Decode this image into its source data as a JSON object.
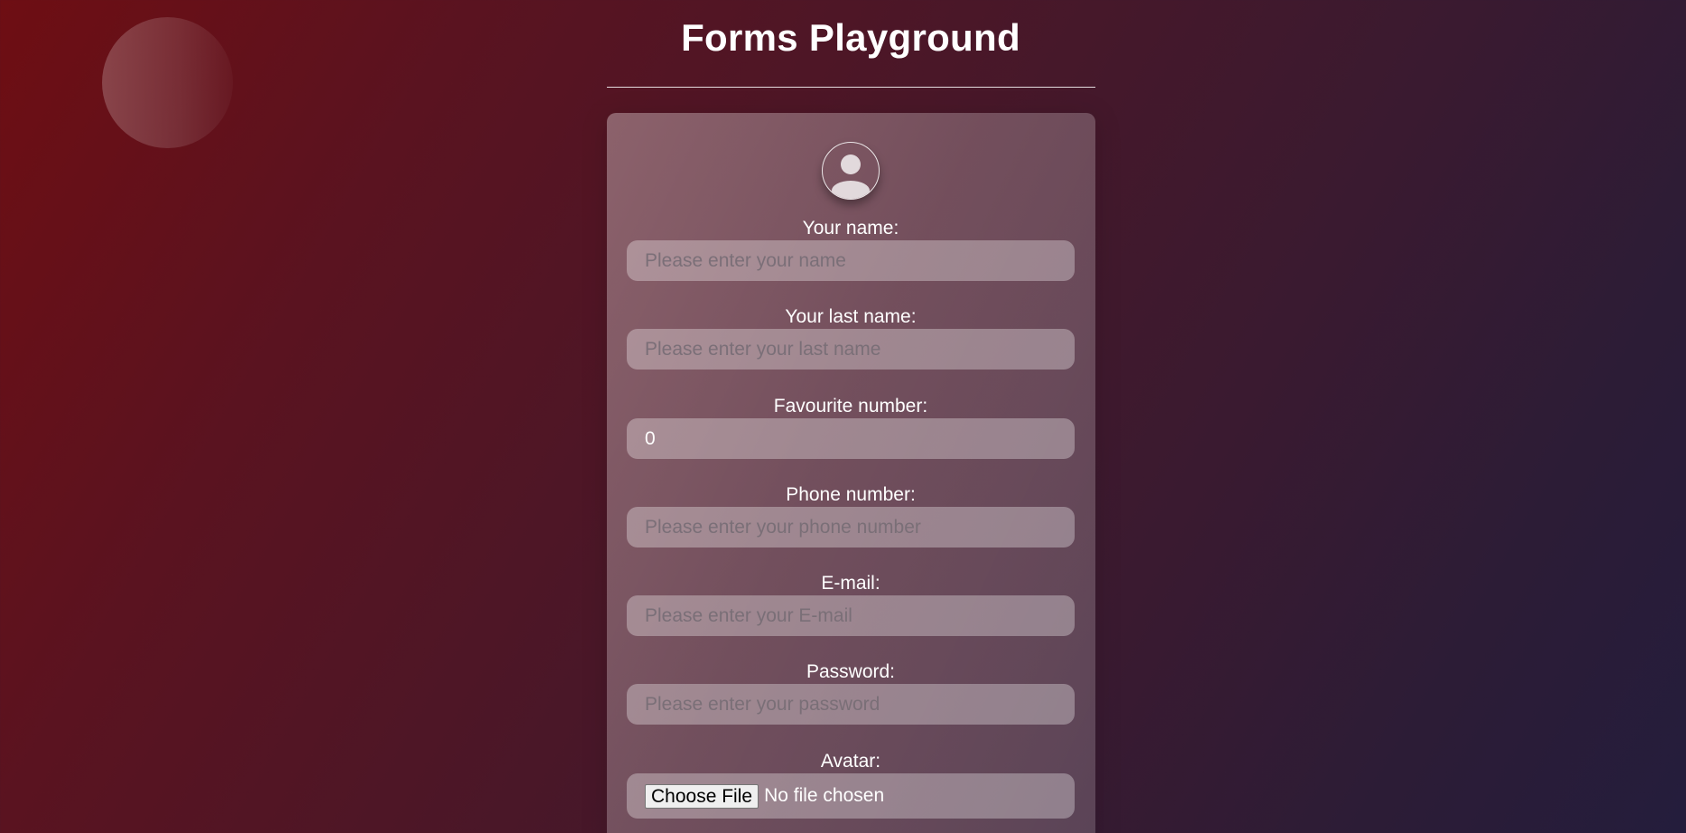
{
  "page": {
    "title": "Forms Playground"
  },
  "avatar": {
    "icon": "user-icon"
  },
  "form": {
    "first_name": {
      "label": "Your name:",
      "placeholder": "Please enter your name",
      "value": ""
    },
    "last_name": {
      "label": "Your last name:",
      "placeholder": "Please enter your last name",
      "value": ""
    },
    "favourite_number": {
      "label": "Favourite number:",
      "value": "0"
    },
    "phone": {
      "label": "Phone number:",
      "placeholder": "Please enter your phone number",
      "value": ""
    },
    "email": {
      "label": "E-mail:",
      "placeholder": "Please enter your E-mail",
      "value": ""
    },
    "password": {
      "label": "Password:",
      "placeholder": "Please enter your password",
      "value": ""
    },
    "avatar_upload": {
      "label": "Avatar:",
      "button_label": "Choose File",
      "status": "No file chosen"
    }
  },
  "colors": {
    "background_start": "#6e0e13",
    "background_end": "#241d3c",
    "text": "#ffffff"
  }
}
